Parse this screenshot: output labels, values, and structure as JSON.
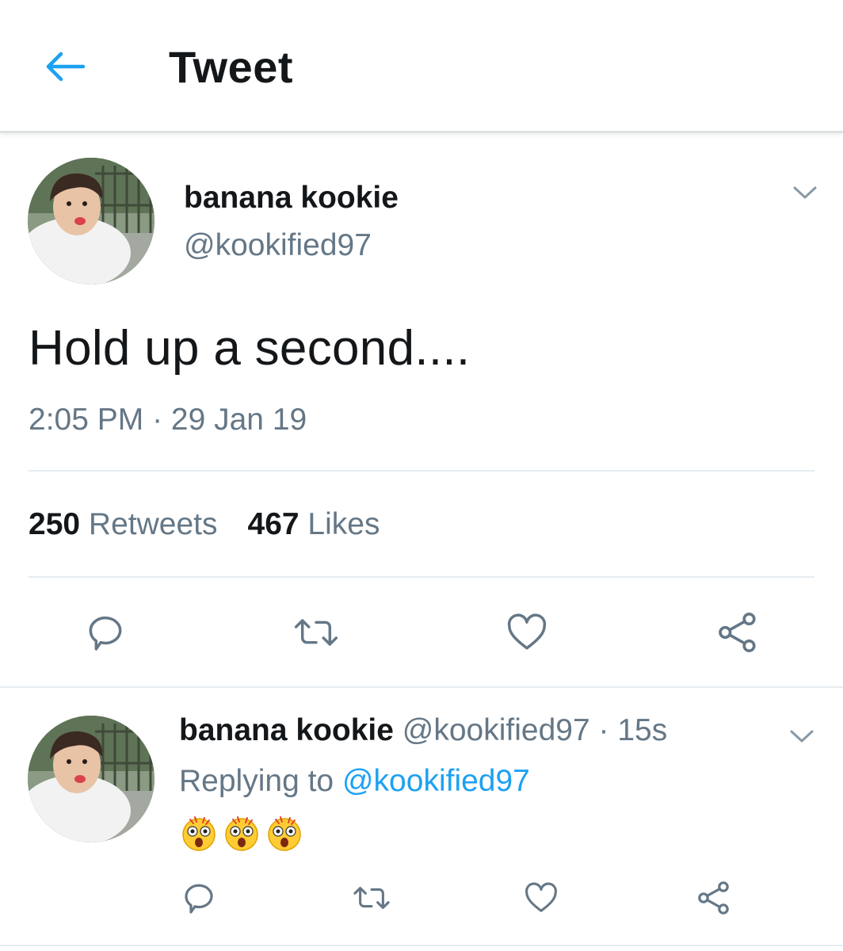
{
  "header": {
    "back_icon": "arrow-left-icon",
    "title": "Tweet",
    "accent_color": "#1da1f2"
  },
  "main_tweet": {
    "author_name": "banana kookie",
    "author_handle": "@kookified97",
    "text": "Hold up a second....",
    "timestamp": "2:05 PM · 29 Jan 19",
    "retweets_count": "250",
    "retweets_label": "Retweets",
    "likes_count": "467",
    "likes_label": "Likes",
    "actions": [
      "reply-icon",
      "retweet-icon",
      "like-icon",
      "share-icon"
    ]
  },
  "reply_tweet": {
    "author_name": "banana kookie",
    "meta": "@kookified97 · 15s",
    "replying_prefix": "Replying to",
    "replying_handle": "@kookified97",
    "emojis": [
      "astonished-face-emoji",
      "astonished-face-emoji",
      "astonished-face-emoji"
    ],
    "actions": [
      "reply-icon",
      "retweet-icon",
      "like-icon",
      "share-icon"
    ]
  },
  "colors": {
    "text_primary": "#14171a",
    "text_secondary": "#657786",
    "link": "#1da1f2",
    "divider": "#e6ecf0"
  }
}
